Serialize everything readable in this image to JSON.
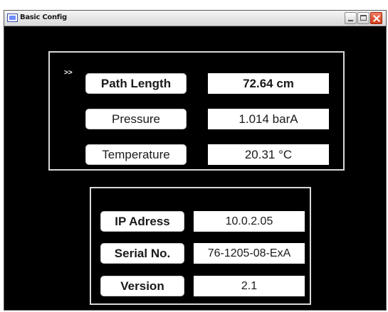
{
  "window": {
    "title": "Basic Config",
    "icon": "app-window-icon",
    "controls": {
      "minimize": "minimize-icon",
      "maximize": "maximize-icon",
      "close": "close-icon"
    }
  },
  "colors": {
    "background": "#000000",
    "panel_border": "#d8d8d8",
    "field_background": "#ffffff",
    "close_button": "#d23c14"
  },
  "sensors": {
    "pointer": ">>",
    "rows": [
      {
        "label": "Path Length",
        "value": "72.64 cm"
      },
      {
        "label": "Pressure",
        "value": "1.014 barA"
      },
      {
        "label": "Temperature",
        "value": "20.31 °C"
      }
    ]
  },
  "device_info": {
    "rows": [
      {
        "label": "IP Adress",
        "value": "10.0.2.05"
      },
      {
        "label": "Serial No.",
        "value": "76-1205-08-ExA"
      },
      {
        "label": "Version",
        "value": "2.1"
      }
    ]
  }
}
